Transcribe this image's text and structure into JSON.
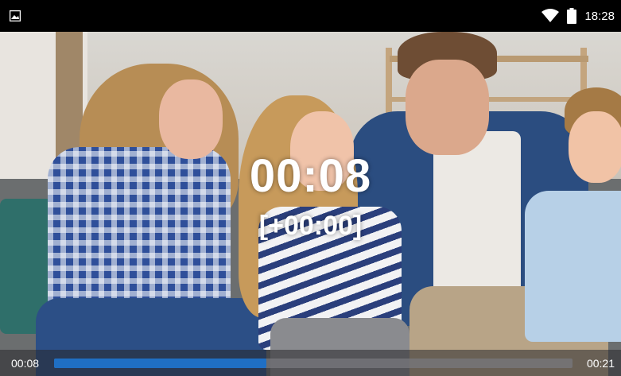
{
  "status_bar": {
    "time": "18:28",
    "icons": [
      "image-icon",
      "wifi-icon",
      "battery-icon"
    ]
  },
  "player": {
    "overlay_time": "00:08",
    "overlay_delta": "[+00:00]",
    "current_time": "00:08",
    "total_time": "00:21",
    "progress_fraction": 0.41
  },
  "colors": {
    "progress_fill": "#1f6fc4",
    "status_bar_bg": "#000000"
  }
}
